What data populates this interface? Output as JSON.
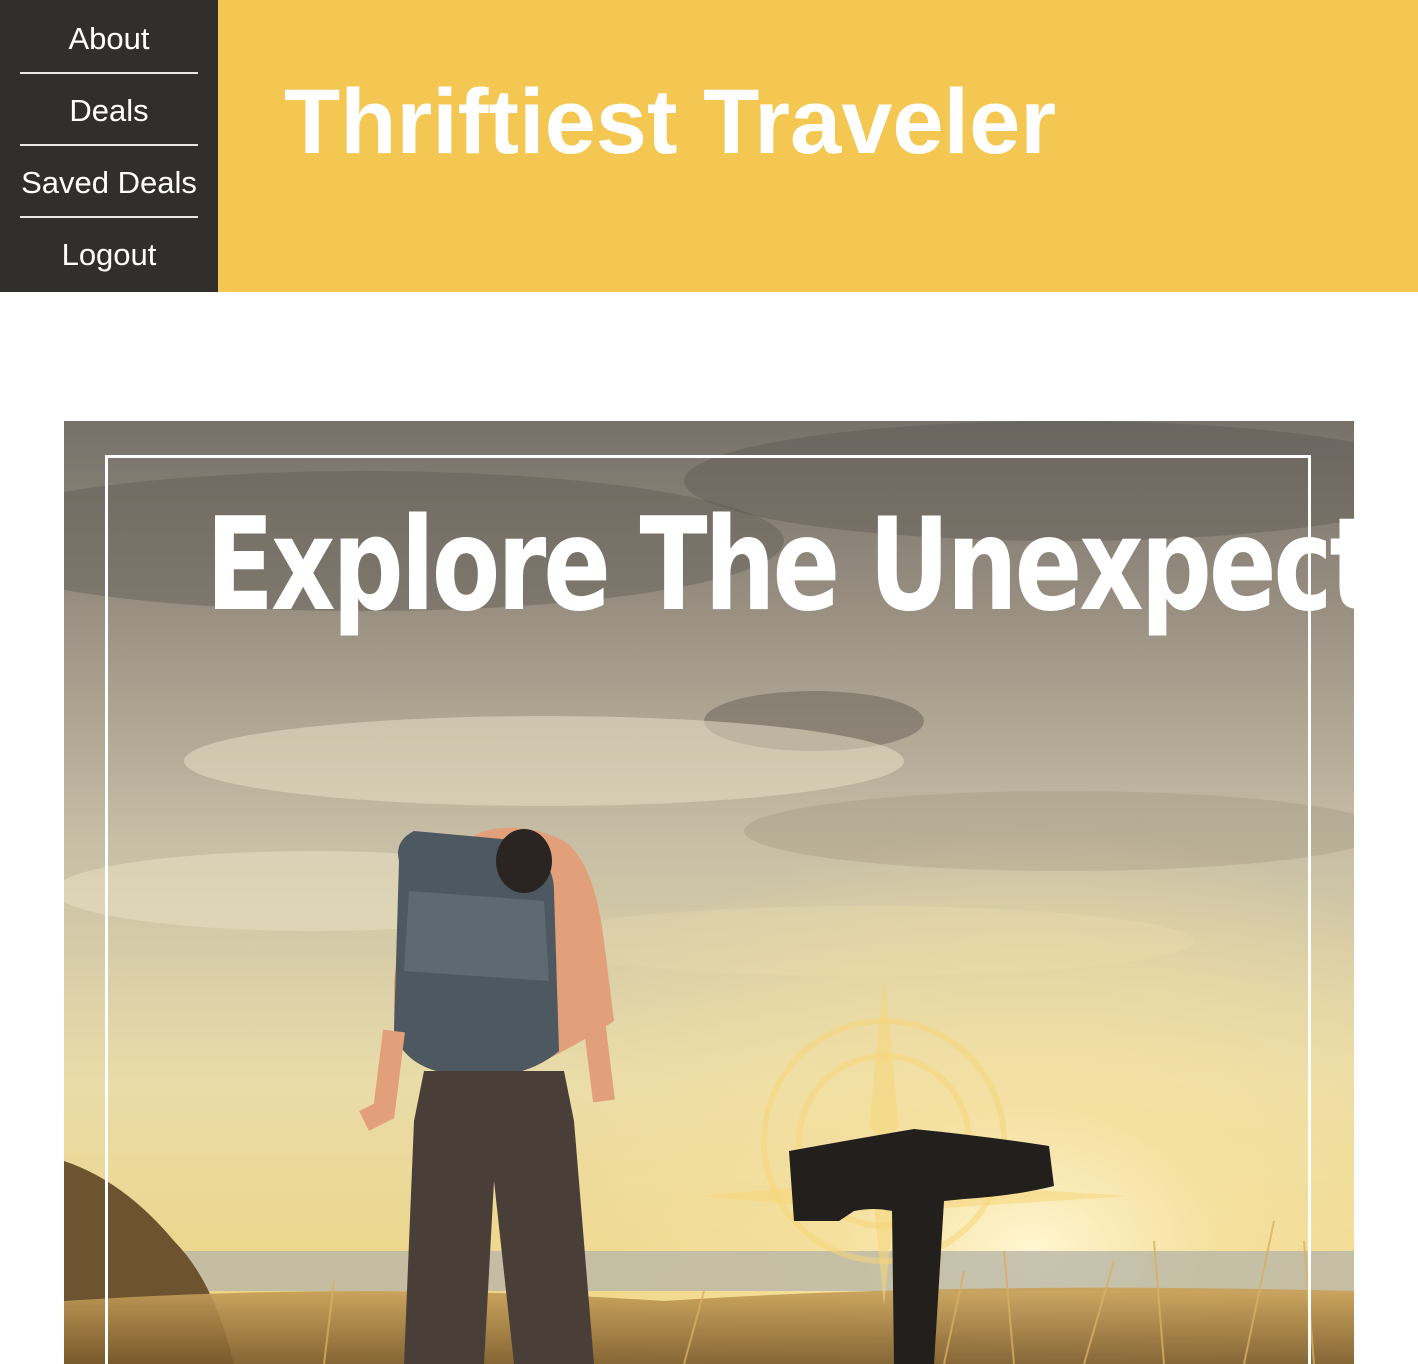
{
  "nav": {
    "items": [
      {
        "label": "About"
      },
      {
        "label": "Deals"
      },
      {
        "label": "Saved Deals"
      },
      {
        "label": "Logout"
      }
    ]
  },
  "header": {
    "title": "Thriftiest Traveler"
  },
  "hero": {
    "headline": "Explore The Unexpected",
    "image_icon": "backpacker-photo-icon",
    "logo_icon": "compass-t-logo-icon"
  },
  "colors": {
    "nav_bg": "#302f2b",
    "banner_bg": "#f3c752",
    "title_text": "#ffffff"
  }
}
